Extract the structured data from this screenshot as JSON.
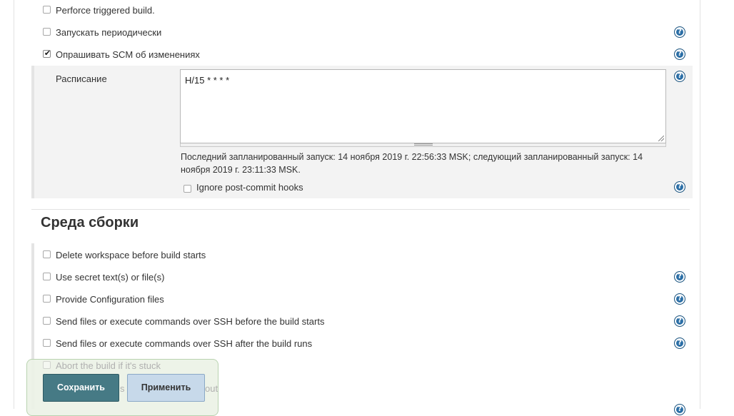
{
  "triggers": {
    "perforce": {
      "label": "Perforce triggered build.",
      "checked": false
    },
    "periodic": {
      "label": "Запускать периодически",
      "checked": false
    },
    "poll_scm": {
      "label": "Опрашивать SCM об изменениях",
      "checked": true
    }
  },
  "schedule": {
    "label": "Расписание",
    "value": "H/15 * * * *",
    "description": "Последний запланированный запуск: 14 ноября 2019 г. 22:56:33 MSK; следующий запланированный запуск: 14 ноября 2019 г. 23:11:33 MSK.",
    "ignore_hooks_label": "Ignore post-commit hooks"
  },
  "build_env": {
    "title": "Среда сборки",
    "options": [
      {
        "label": "Delete workspace before build starts",
        "checked": false
      },
      {
        "label": "Use secret text(s) or file(s)",
        "checked": false
      },
      {
        "label": "Provide Configuration files",
        "checked": false
      },
      {
        "label": "Send files or execute commands over SSH before the build starts",
        "checked": false
      },
      {
        "label": "Send files or execute commands over SSH after the build runs",
        "checked": false
      },
      {
        "label": "Abort the build if it's stuck",
        "checked": false
      }
    ],
    "partial_text": "s t",
    "partial_text_2": "out"
  },
  "help_icon_glyph": "?",
  "check_glyph": "✔",
  "actions": {
    "save_label": "Сохранить",
    "apply_label": "Применить"
  },
  "colors": {
    "save_button": "#467a85",
    "apply_button": "#c7d9ea",
    "help_icon": "#2a6ea6"
  }
}
